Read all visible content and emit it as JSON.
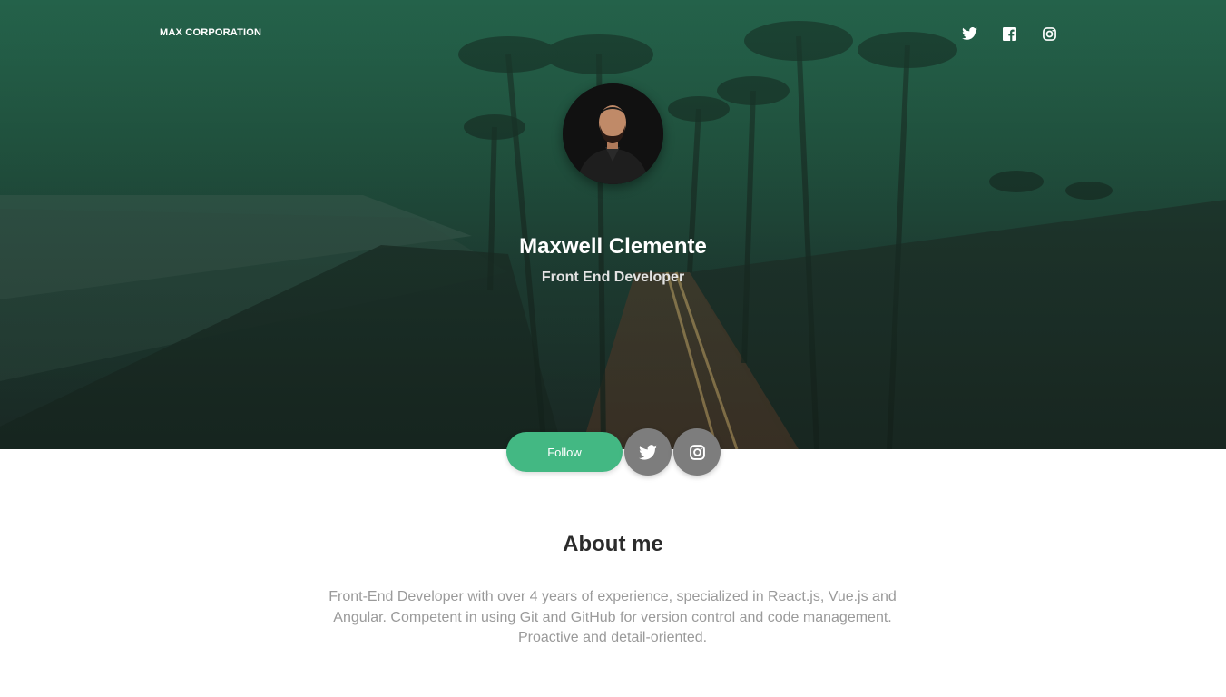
{
  "header": {
    "brand": "MAX CORPORATION",
    "social_icons": [
      "twitter-icon",
      "facebook-icon",
      "instagram-icon"
    ]
  },
  "profile": {
    "name": "Maxwell Clemente",
    "role": "Front End Developer"
  },
  "actions": {
    "follow_label": "Follow",
    "icons": [
      "twitter-icon",
      "instagram-icon"
    ]
  },
  "about": {
    "title": "About me",
    "text": "Front-End Developer with over 4 years of experience, specialized in React.js, Vue.js and Angular. Competent in using Git and GitHub for version control and code management. Proactive and detail-oriented."
  },
  "colors": {
    "accent": "#43b883",
    "hero": "#24614a",
    "circle_button": "#7d7d7d"
  }
}
